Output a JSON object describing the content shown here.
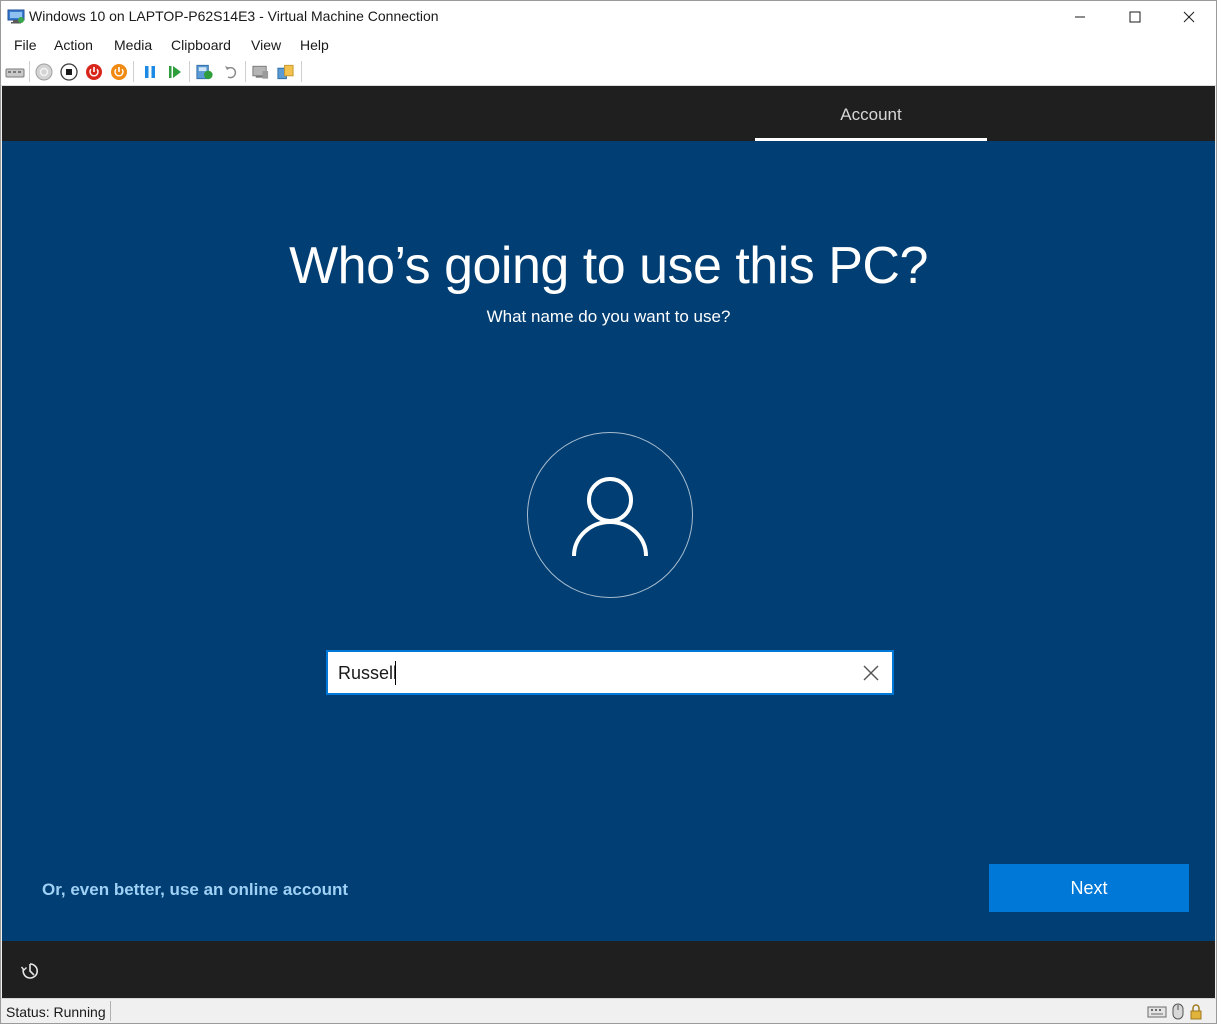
{
  "window": {
    "title": "Windows 10 on LAPTOP-P62S14E3 - Virtual Machine Connection",
    "app_icon": "vm-connection-icon",
    "controls": [
      "minimize-icon",
      "maximize-icon",
      "close-icon"
    ]
  },
  "menu": {
    "items": [
      {
        "label": "File"
      },
      {
        "label": "Action"
      },
      {
        "label": "Media"
      },
      {
        "label": "Clipboard"
      },
      {
        "label": "View"
      },
      {
        "label": "Help"
      }
    ]
  },
  "toolbar": {
    "buttons": [
      {
        "icon": "ctrl-alt-del-icon"
      },
      {
        "icon": "start-icon"
      },
      {
        "icon": "turn-off-icon"
      },
      {
        "icon": "shut-down-icon"
      },
      {
        "icon": "save-icon"
      },
      {
        "icon": "pause-icon"
      },
      {
        "icon": "resume-icon"
      },
      {
        "icon": "checkpoint-icon"
      },
      {
        "icon": "revert-icon"
      },
      {
        "icon": "enhanced-session-icon"
      },
      {
        "icon": "share-icon"
      }
    ]
  },
  "vm": {
    "step_label": "Account",
    "title": "Who’s going to use this PC?",
    "subtitle": "What name do you want to use?",
    "avatar_icon": "user-icon",
    "name_input_value": "Russell",
    "clear_icon": "clear-icon",
    "online_account_link": "Or, even better, use an online account",
    "next_label": "Next",
    "accessibility_icon": "ease-of-access-icon"
  },
  "status": {
    "text": "Status: Running",
    "icons": [
      "keyboard-icon",
      "mouse-icon",
      "lock-icon"
    ]
  },
  "colors": {
    "oobe_blue": "#003e73",
    "header_dark": "#1f1f1f",
    "accent": "#0078d7",
    "link": "#9fd0f5"
  }
}
